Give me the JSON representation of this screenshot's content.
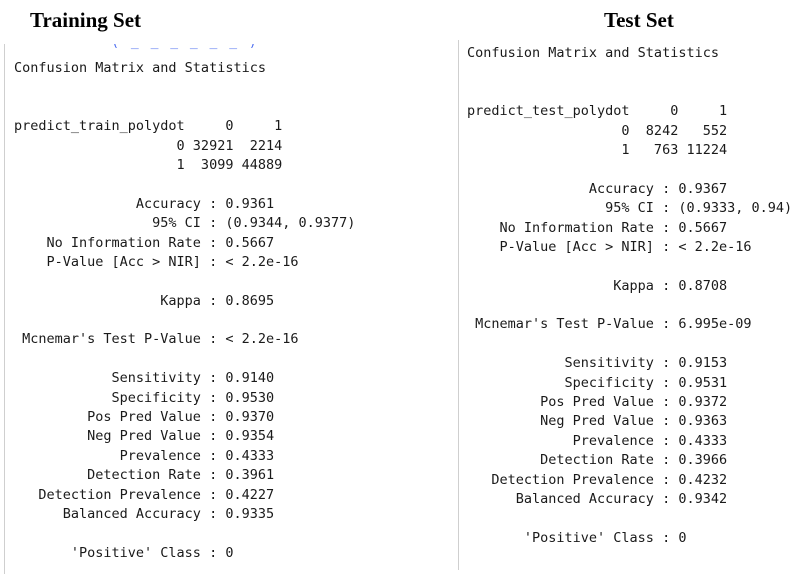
{
  "training": {
    "heading": "Training Set",
    "lines": [
      "Confusion Matrix and Statistics",
      "",
      "",
      "predict_train_polydot     0     1",
      "                    0 32921  2214",
      "                    1  3099 44889",
      "",
      "               Accuracy : 0.9361",
      "                 95% CI : (0.9344, 0.9377)",
      "    No Information Rate : 0.5667",
      "    P-Value [Acc > NIR] : < 2.2e-16",
      "",
      "                  Kappa : 0.8695",
      "",
      " Mcnemar's Test P-Value : < 2.2e-16",
      "",
      "            Sensitivity : 0.9140",
      "            Specificity : 0.9530",
      "         Pos Pred Value : 0.9370",
      "         Neg Pred Value : 0.9354",
      "             Prevalence : 0.4333",
      "         Detection Rate : 0.3961",
      "   Detection Prevalence : 0.4227",
      "      Balanced Accuracy : 0.9335",
      "",
      "       'Positive' Class : 0"
    ]
  },
  "test": {
    "heading": "Test Set",
    "lines": [
      "Confusion Matrix and Statistics",
      "",
      "",
      "predict_test_polydot     0     1",
      "                   0  8242   552",
      "                   1   763 11224",
      "",
      "               Accuracy : 0.9367",
      "                 95% CI : (0.9333, 0.94)",
      "    No Information Rate : 0.5667",
      "    P-Value [Acc > NIR] : < 2.2e-16",
      "",
      "                  Kappa : 0.8708",
      "",
      " Mcnemar's Test P-Value : 6.995e-09",
      "",
      "            Sensitivity : 0.9153",
      "            Specificity : 0.9531",
      "         Pos Pred Value : 0.9372",
      "         Neg Pred Value : 0.9363",
      "             Prevalence : 0.4333",
      "         Detection Rate : 0.3966",
      "   Detection Prevalence : 0.4232",
      "      Balanced Accuracy : 0.9342",
      "",
      "       'Positive' Class : 0"
    ]
  },
  "colors": {
    "text": "#1a1a1a",
    "heading": "#000000",
    "panel_border": "#cfcfcf",
    "clipped_link": "#4a6cf0"
  }
}
